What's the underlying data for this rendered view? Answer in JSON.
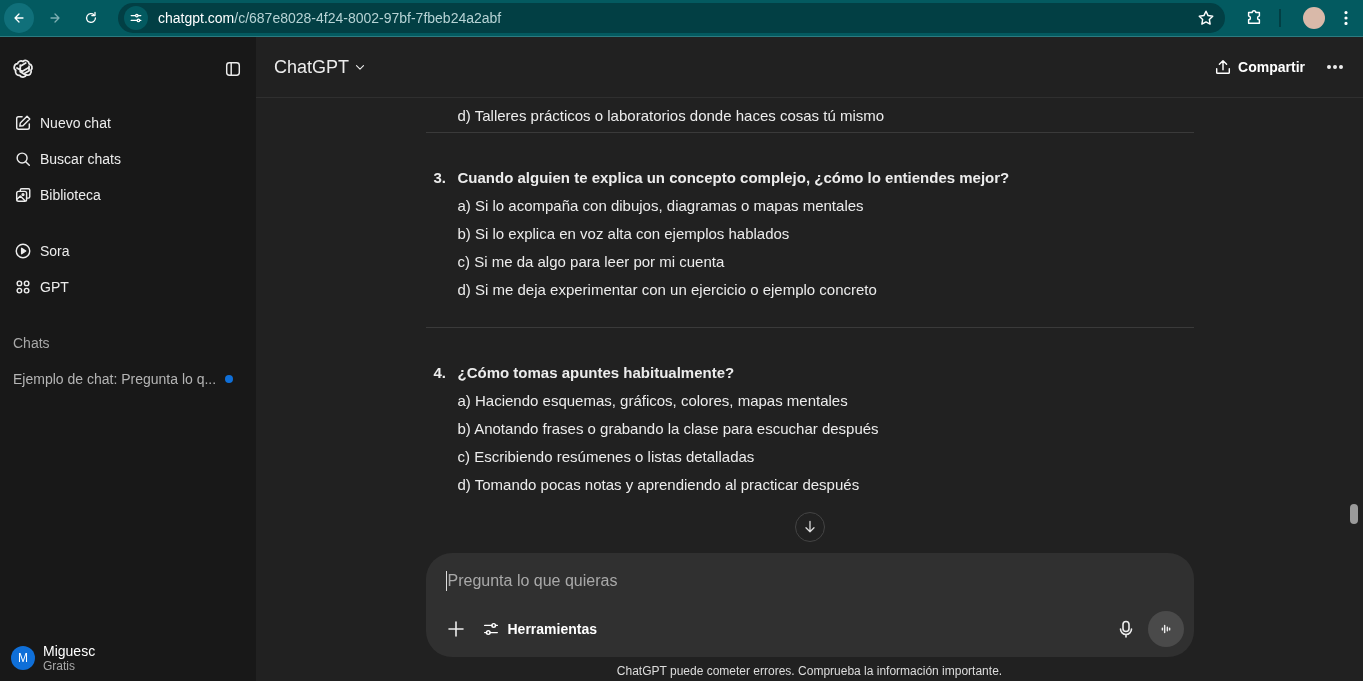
{
  "browser": {
    "url_host": "chatgpt.com",
    "url_path": "/c/687e8028-4f24-8002-97bf-7fbeb24a2abf"
  },
  "sidebar": {
    "nav": [
      {
        "label": "Nuevo chat",
        "kind": "new"
      },
      {
        "label": "Buscar chats",
        "kind": "search"
      },
      {
        "label": "Biblioteca",
        "kind": "library"
      },
      {
        "label": "Sora",
        "kind": "play"
      },
      {
        "label": "GPT",
        "kind": "apps"
      }
    ],
    "section_title": "Chats",
    "chats": [
      {
        "title": "Ejemplo de chat: Pregunta lo q...",
        "unread": true
      }
    ],
    "user": {
      "initial": "M",
      "name": "Miguesc",
      "plan": "Gratis"
    }
  },
  "header": {
    "model": "ChatGPT",
    "share": "Compartir"
  },
  "conversation": {
    "leading_option": "d) Talleres prácticos o laboratorios donde haces cosas tú mismo",
    "questions": [
      {
        "number": "3.",
        "text": "Cuando alguien te explica un concepto complejo, ¿cómo lo entiendes mejor?",
        "options": [
          "a) Si lo acompaña con dibujos, diagramas o mapas mentales",
          "b) Si lo explica en voz alta con ejemplos hablados",
          "c) Si me da algo para leer por mi cuenta",
          "d) Si me deja experimentar con un ejercicio o ejemplo concreto"
        ]
      },
      {
        "number": "4.",
        "text": "¿Cómo tomas apuntes habitualmente?",
        "options": [
          "a) Haciendo esquemas, gráficos, colores, mapas mentales",
          "b) Anotando frases o grabando la clase para escuchar después",
          "c) Escribiendo resúmenes o listas detalladas",
          "d) Tomando pocas notas y aprendiendo al practicar después"
        ]
      }
    ]
  },
  "composer": {
    "placeholder": "Pregunta lo que quieras",
    "tools": "Herramientas"
  },
  "disclaimer": "ChatGPT puede cometer errores. Comprueba la información importante."
}
